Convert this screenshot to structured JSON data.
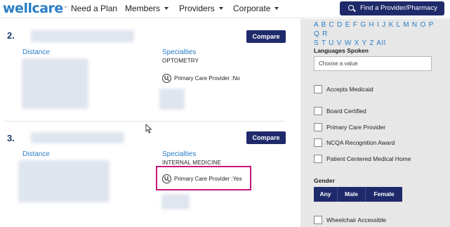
{
  "header": {
    "logo_text": "wellcare",
    "logo_mark": "™",
    "nav": [
      {
        "label": "Need a Plan"
      },
      {
        "label": "Members"
      },
      {
        "label": "Providers"
      },
      {
        "label": "Corporate"
      }
    ],
    "find_button_label": "Find a Provider/Pharmacy"
  },
  "results": [
    {
      "number": "2.",
      "compare_label": "Compare",
      "distance_label": "Distance",
      "specialties_label": "Specialties",
      "specialty": "OPTOMETRY",
      "pcp_text": "Primary Care Provider :No"
    },
    {
      "number": "3.",
      "compare_label": "Compare",
      "distance_label": "Distance",
      "specialties_label": "Specialties",
      "specialty": "INTERNAL MEDICINE",
      "pcp_text": "Primary Care Provider :Yes"
    }
  ],
  "sidebar": {
    "alphabet_line1": "A B C D E F G H I J K L M N O P Q R",
    "alphabet_line2": "S T U V W X Y Z All",
    "languages_label": "Languages Spoken",
    "languages_placeholder": "Choose a value",
    "checkbox_group1": [
      {
        "label": "Accepts Medicaid",
        "checked": false
      }
    ],
    "checkbox_group2": [
      {
        "label": "Board Certified",
        "checked": false
      },
      {
        "label": "Primary Care Provider",
        "checked": false
      },
      {
        "label": "NCQA Recognition Award",
        "checked": false
      },
      {
        "label": "Patient Centered Medical Home",
        "checked": false
      }
    ],
    "gender_label": "Gender",
    "gender_options": [
      "Any",
      "Male",
      "Female"
    ],
    "wheelchair_label": "Wheelchair Accessible"
  },
  "colors": {
    "brand_blue": "#2a7dc5",
    "navy": "#1f2a6b",
    "highlight": "#c8197a"
  }
}
